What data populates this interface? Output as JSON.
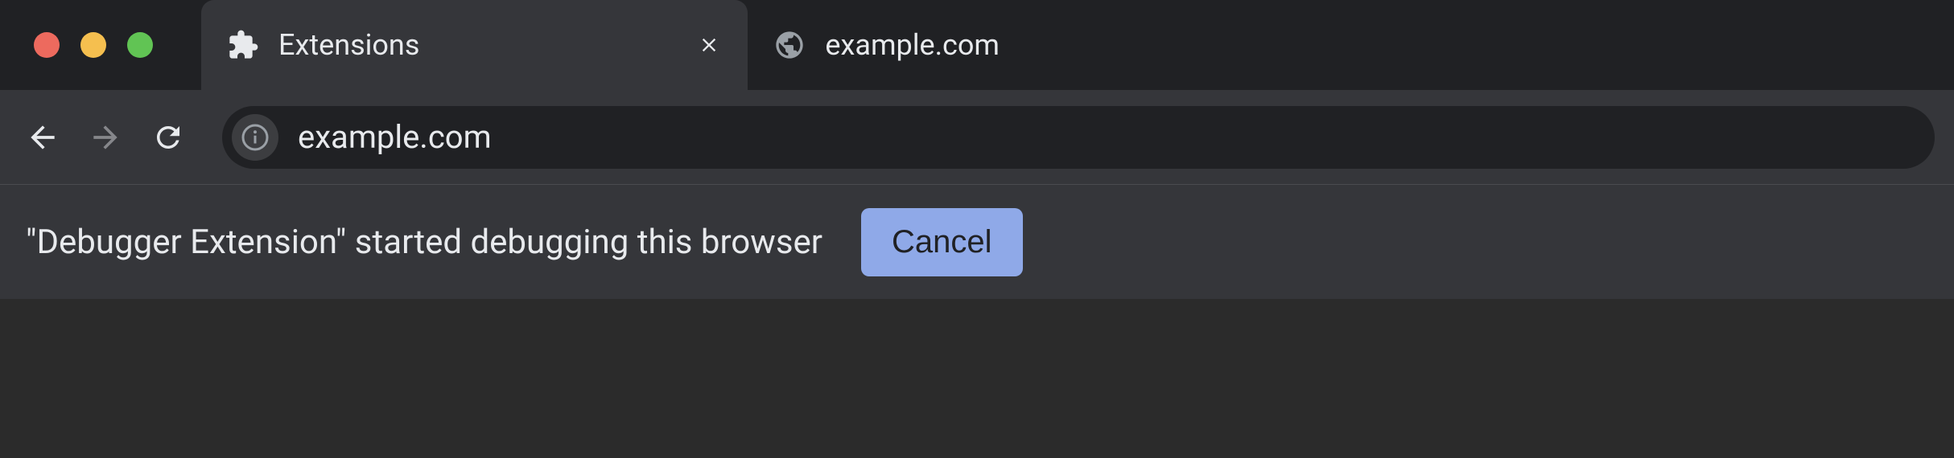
{
  "window": {
    "traffic_lights": {
      "close_color": "#ed6a5e",
      "minimize_color": "#f5bf4f",
      "zoom_color": "#61c454"
    }
  },
  "tabs": [
    {
      "title": "Extensions",
      "favicon": "extension-puzzle-icon",
      "active": true,
      "closeable": true
    },
    {
      "title": "example.com",
      "favicon": "globe-icon",
      "active": false,
      "closeable": false
    }
  ],
  "toolbar": {
    "back_enabled": true,
    "forward_enabled": false,
    "reload_label": "Reload"
  },
  "address_bar": {
    "url": "example.com",
    "site_info_icon": "info-icon"
  },
  "infobar": {
    "message": "\"Debugger Extension\" started debugging this browser",
    "cancel_label": "Cancel"
  },
  "colors": {
    "tab_active_bg": "#35363a",
    "titlebar_bg": "#202124",
    "toolbar_bg": "#35363a",
    "omnibox_bg": "#202124",
    "button_accent": "#8fa9e8"
  }
}
